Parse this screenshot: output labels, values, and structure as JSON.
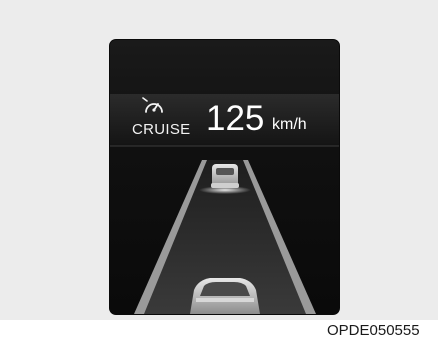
{
  "display": {
    "cruise_icon": "speedometer-icon",
    "cruise_label": "CRUISE",
    "speed": "125",
    "unit": "km/h"
  },
  "caption": "OPDE050555",
  "colors": {
    "background": "#ececec",
    "cluster": "#111111",
    "text": "#ffffff"
  }
}
